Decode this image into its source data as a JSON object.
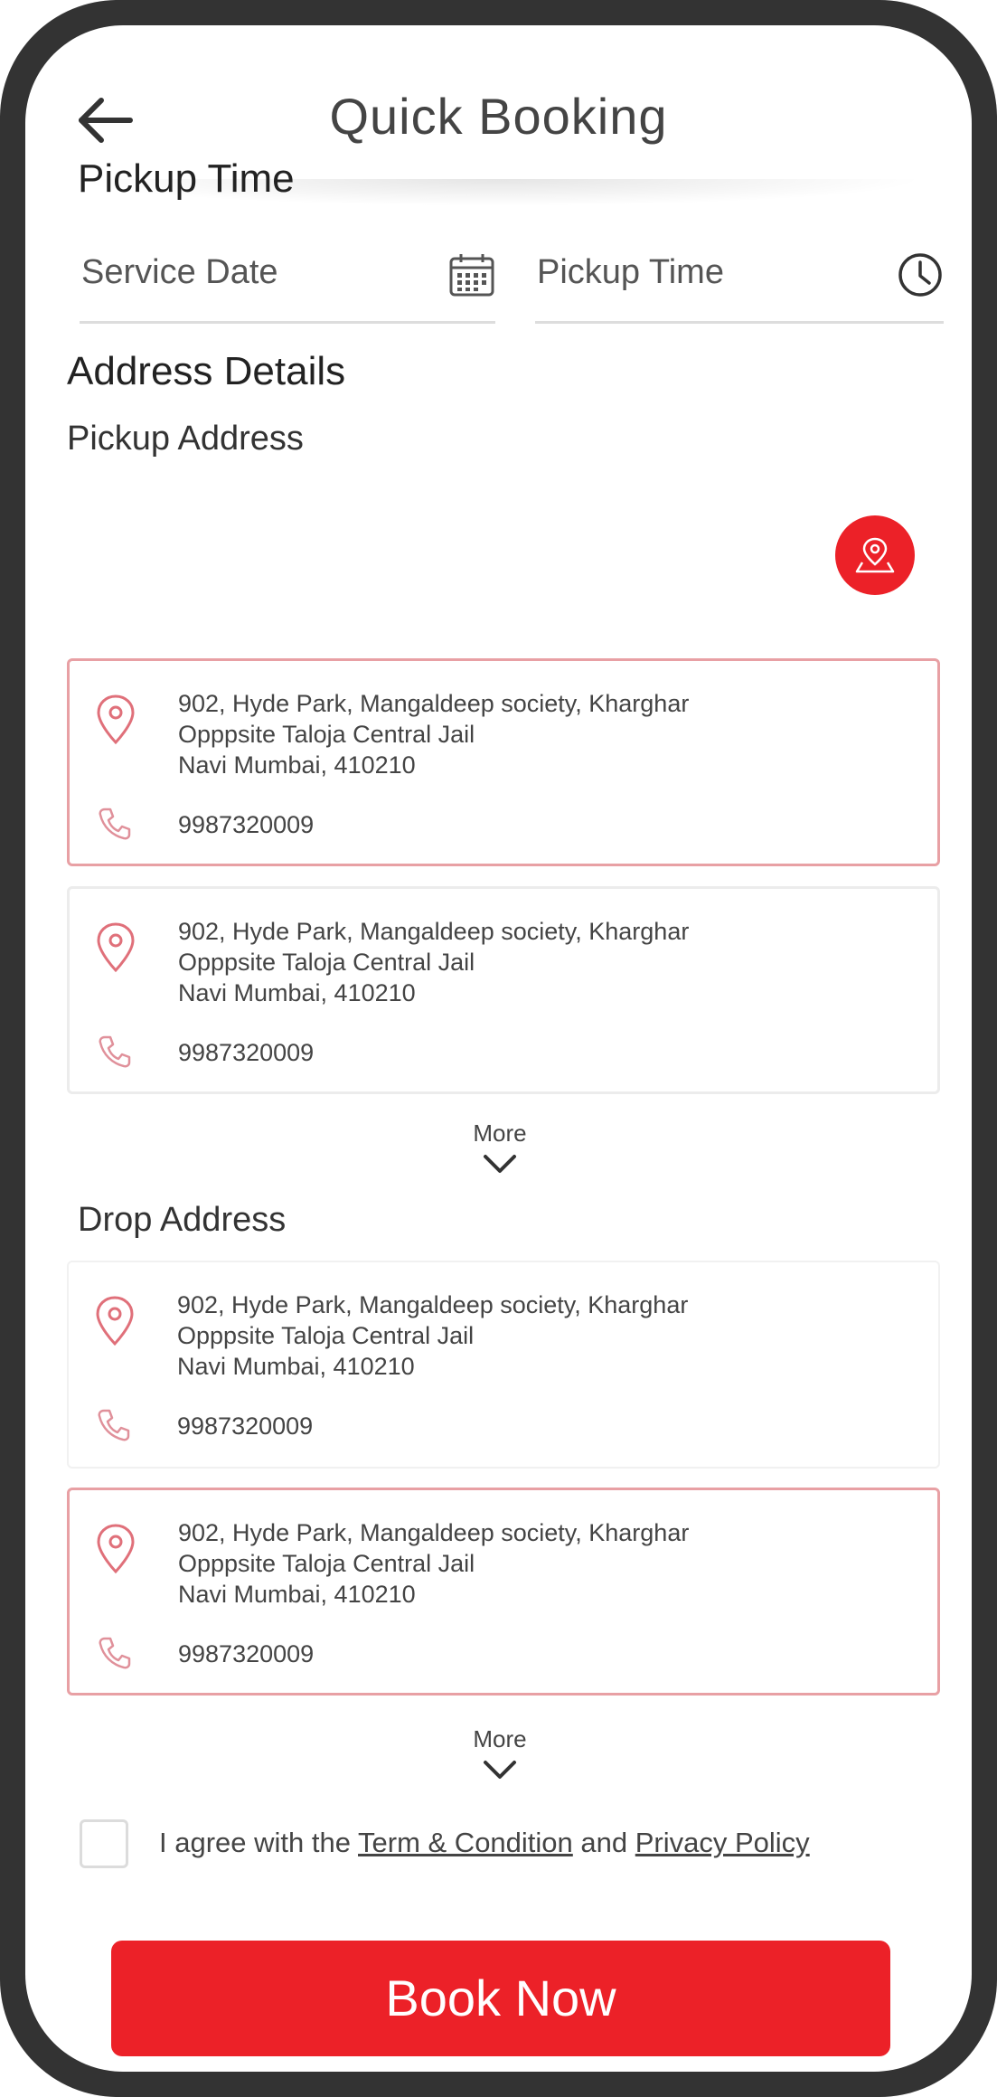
{
  "header": {
    "title": "Quick Booking"
  },
  "pickup_time_section": {
    "title": "Pickup Time",
    "service_date_label": "Service Date",
    "pickup_time_label": "Pickup Time",
    "calendar_icon": "calendar-icon",
    "clock_icon": "clock-icon"
  },
  "address_section": {
    "title": "Address Details",
    "map_icon": "map-pin-icon",
    "pickup_title": "Pickup Address",
    "drop_title": "Drop Address",
    "more_label": "More"
  },
  "pickup_addresses": [
    {
      "line1": "902, Hyde Park, Mangaldeep society, Kharghar",
      "line2": "Opppsite Taloja Central Jail",
      "line3": "Navi Mumbai, 410210",
      "phone": "9987320009",
      "selected": true
    },
    {
      "line1": "902, Hyde Park, Mangaldeep society, Kharghar",
      "line2": "Opppsite Taloja Central Jail",
      "line3": "Navi Mumbai, 410210",
      "phone": "9987320009",
      "selected": false
    }
  ],
  "drop_addresses": [
    {
      "line1": "902, Hyde Park, Mangaldeep society, Kharghar",
      "line2": "Opppsite Taloja Central Jail",
      "line3": "Navi Mumbai, 410210",
      "phone": "9987320009",
      "selected": false
    },
    {
      "line1": "902, Hyde Park, Mangaldeep society, Kharghar",
      "line2": "Opppsite Taloja Central Jail",
      "line3": "Navi Mumbai, 410210",
      "phone": "9987320009",
      "selected": true
    }
  ],
  "agreement": {
    "prefix": "I agree with the ",
    "terms_link": "Term & Condition",
    "middle": " and ",
    "privacy_link": "Privacy Policy",
    "checked": false
  },
  "cta": {
    "book_label": "Book Now"
  },
  "colors": {
    "accent": "#ec2128",
    "frame": "#333333",
    "selected_border": "#e8a0a4",
    "icon_red": "#e0707a"
  }
}
